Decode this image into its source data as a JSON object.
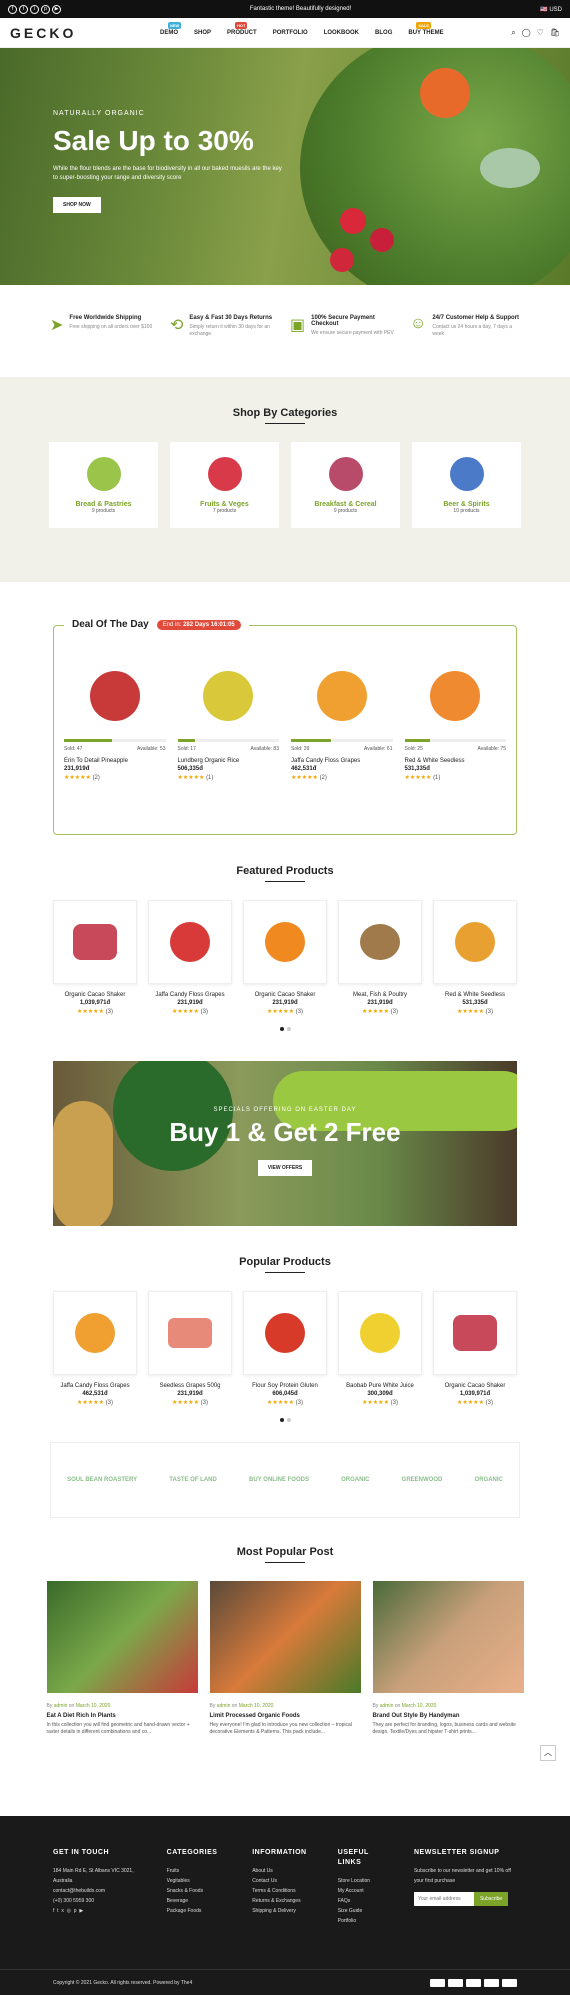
{
  "topbar": {
    "announcement": "Fantastic theme! Beautifully designed!",
    "currency": "USD"
  },
  "header": {
    "logo": "GECKO",
    "nav": [
      {
        "label": "DEMO",
        "badge": "New",
        "badge_color": "#3bb0d8"
      },
      {
        "label": "SHOP"
      },
      {
        "label": "PRODUCT",
        "badge": "Hot",
        "badge_color": "#e04a3a"
      },
      {
        "label": "PORTFOLIO"
      },
      {
        "label": "LOOKBOOK"
      },
      {
        "label": "BLOG"
      },
      {
        "label": "BUY THEME",
        "badge": "Sale",
        "badge_color": "#f0a500"
      }
    ]
  },
  "hero": {
    "subtitle": "NATURALLY ORGANIC",
    "title": "Sale Up to 30%",
    "desc": "While the flour blends are the base for biodiversity in all our baked muesils are the key to super-boosting your range and diversity score",
    "button": "SHOP NOW"
  },
  "features": [
    {
      "title": "Free Worldwide Shipping",
      "desc": "Free shipping on all orders over $100",
      "icon": "plane-icon"
    },
    {
      "title": "Easy & Fast 30 Days Returns",
      "desc": "Simply return it within 30 days for an exchange.",
      "icon": "return-icon"
    },
    {
      "title": "100% Secure Payment Checkout",
      "desc": "We ensure secure payment with PEV",
      "icon": "wallet-icon"
    },
    {
      "title": "24/7 Customer Help & Support",
      "desc": "Contact us 24 hours a day, 7 days a week",
      "icon": "support-icon"
    }
  ],
  "categories": {
    "title": "Shop By Categories",
    "items": [
      {
        "name": "Bread & Pastries",
        "count": "9 products",
        "color": "#9bc44a"
      },
      {
        "name": "Fruits & Veges",
        "count": "7 products",
        "color": "#d83a4a"
      },
      {
        "name": "Breakfast & Cereal",
        "count": "9 products",
        "color": "#b84a6a"
      },
      {
        "name": "Beer & Spirits",
        "count": "10 products",
        "color": "#4a7ac8"
      }
    ]
  },
  "deal": {
    "title": "Deal Of The Day",
    "ends_label": "End in:",
    "timer": "282 Days 16:01:05",
    "items": [
      {
        "name": "Erin To Detail Pineapple",
        "price": "231,919đ",
        "sold": "Sold: 47",
        "available": "Available: 53",
        "progress": 0.47,
        "color": "#c83a3a"
      },
      {
        "name": "Lundberg Organic Rice",
        "price": "506,335đ",
        "sold": "Sold: 17",
        "available": "Available: 83",
        "progress": 0.17,
        "color": "#d8c83a"
      },
      {
        "name": "Jaffa Candy Floss Grapes",
        "price": "462,531đ",
        "sold": "Sold: 39",
        "available": "Available: 61",
        "progress": 0.39,
        "color": "#f0a030"
      },
      {
        "name": "Red & White Seedless",
        "price": "531,335đ",
        "sold": "Sold: 25",
        "available": "Available: 75",
        "progress": 0.25,
        "color": "#f08a30"
      }
    ]
  },
  "featured": {
    "title": "Featured Products",
    "items": [
      {
        "name": "Organic Cacao Shaker",
        "price": "1,039,971đ",
        "reviews": "(3)",
        "color": "#c84a5a"
      },
      {
        "name": "Jaffa Candy Floss Grapes",
        "price": "231,919đ",
        "reviews": "(3)",
        "color": "#d83a3a"
      },
      {
        "name": "Organic Cacao Shaker",
        "price": "231,919đ",
        "reviews": "(3)",
        "color": "#f08a20"
      },
      {
        "name": "Meat, Fish & Poultry",
        "price": "231,919đ",
        "reviews": "(3)",
        "color": "#a07a4a"
      },
      {
        "name": "Red & White Seedless",
        "price": "531,335đ",
        "reviews": "(3)",
        "color": "#e8a030"
      }
    ]
  },
  "banner": {
    "subtitle": "SPECIALS OFFERING ON EASTER DAY",
    "title": "Buy 1 & Get 2 Free",
    "button": "VIEW OFFERS"
  },
  "popular": {
    "title": "Popular Products",
    "items": [
      {
        "name": "Jaffa Candy Floss Grapes",
        "price": "462,531đ",
        "reviews": "(3)",
        "color": "#f0a030"
      },
      {
        "name": "Seedless Grapes 500g",
        "price": "231,919đ",
        "reviews": "(3)",
        "color": "#e88a7a"
      },
      {
        "name": "Flour Soy Protein Gluten",
        "price": "606,045đ",
        "reviews": "(3)",
        "color": "#d83a2a"
      },
      {
        "name": "Baobab Pure White Juice",
        "price": "300,309đ",
        "reviews": "(3)",
        "color": "#f0d030"
      },
      {
        "name": "Organic Cacao Shaker",
        "price": "1,039,971đ",
        "reviews": "(3)",
        "color": "#c84a5a"
      }
    ]
  },
  "brands": [
    "Soul Bean Roastery",
    "Taste of Land",
    "Buy Online Foods",
    "Organic",
    "Greenwood",
    "Organic"
  ],
  "posts": {
    "title": "Most Popular Post",
    "items": [
      {
        "author": "admin",
        "date": "March 10, 2020",
        "title": "Eat A Diet Rich In Plants",
        "desc": "In this collection you will find geometric and hand-drawn vector + raster details in different combinations and co...",
        "color": "#5a8a3a"
      },
      {
        "author": "admin",
        "date": "March 10, 2020",
        "title": "Limit Processed Organic Foods",
        "desc": "Hey everyone! I'm glad to introduce you new collection – tropical decorative Elements & Patterns. This pack include...",
        "color": "#d87a3a"
      },
      {
        "author": "admin",
        "date": "March 10, 2020",
        "title": "Brand Out Style By Handyman",
        "desc": "They are perfect for branding, logos, business cards and website design, Textile/Dyes and hipster T-shirt prints...",
        "color": "#c8a07a"
      }
    ]
  },
  "footer": {
    "contact_title": "GET IN TOUCH",
    "address": "184 Main Rd E, St Albans VIC 3021, Australia",
    "email": "contact@thebuilds.com",
    "phone": "(+0) 300 5959 300",
    "cols": [
      {
        "title": "CATEGORIES",
        "items": [
          "Fruits",
          "Vegitables",
          "Snacks & Foods",
          "Beverage",
          "Package Foods"
        ]
      },
      {
        "title": "INFORMATION",
        "items": [
          "About Us",
          "Contact Us",
          "Terms & Conditions",
          "Returns & Exchanges",
          "Shipping & Delivery"
        ]
      },
      {
        "title": "USEFUL LINKS",
        "items": [
          "Store Location",
          "My Account",
          "FAQs",
          "Size Guide",
          "Portfolio"
        ]
      }
    ],
    "newsletter_title": "NEWSLETTER SIGNUP",
    "newsletter_desc": "Subscribe to our newsletter and get 10% off your first purchase",
    "email_placeholder": "Your email address",
    "subscribe": "Subscribe",
    "copyright": "Copyright © 2021 Gecko. All rights reserved. Powered by The4"
  }
}
